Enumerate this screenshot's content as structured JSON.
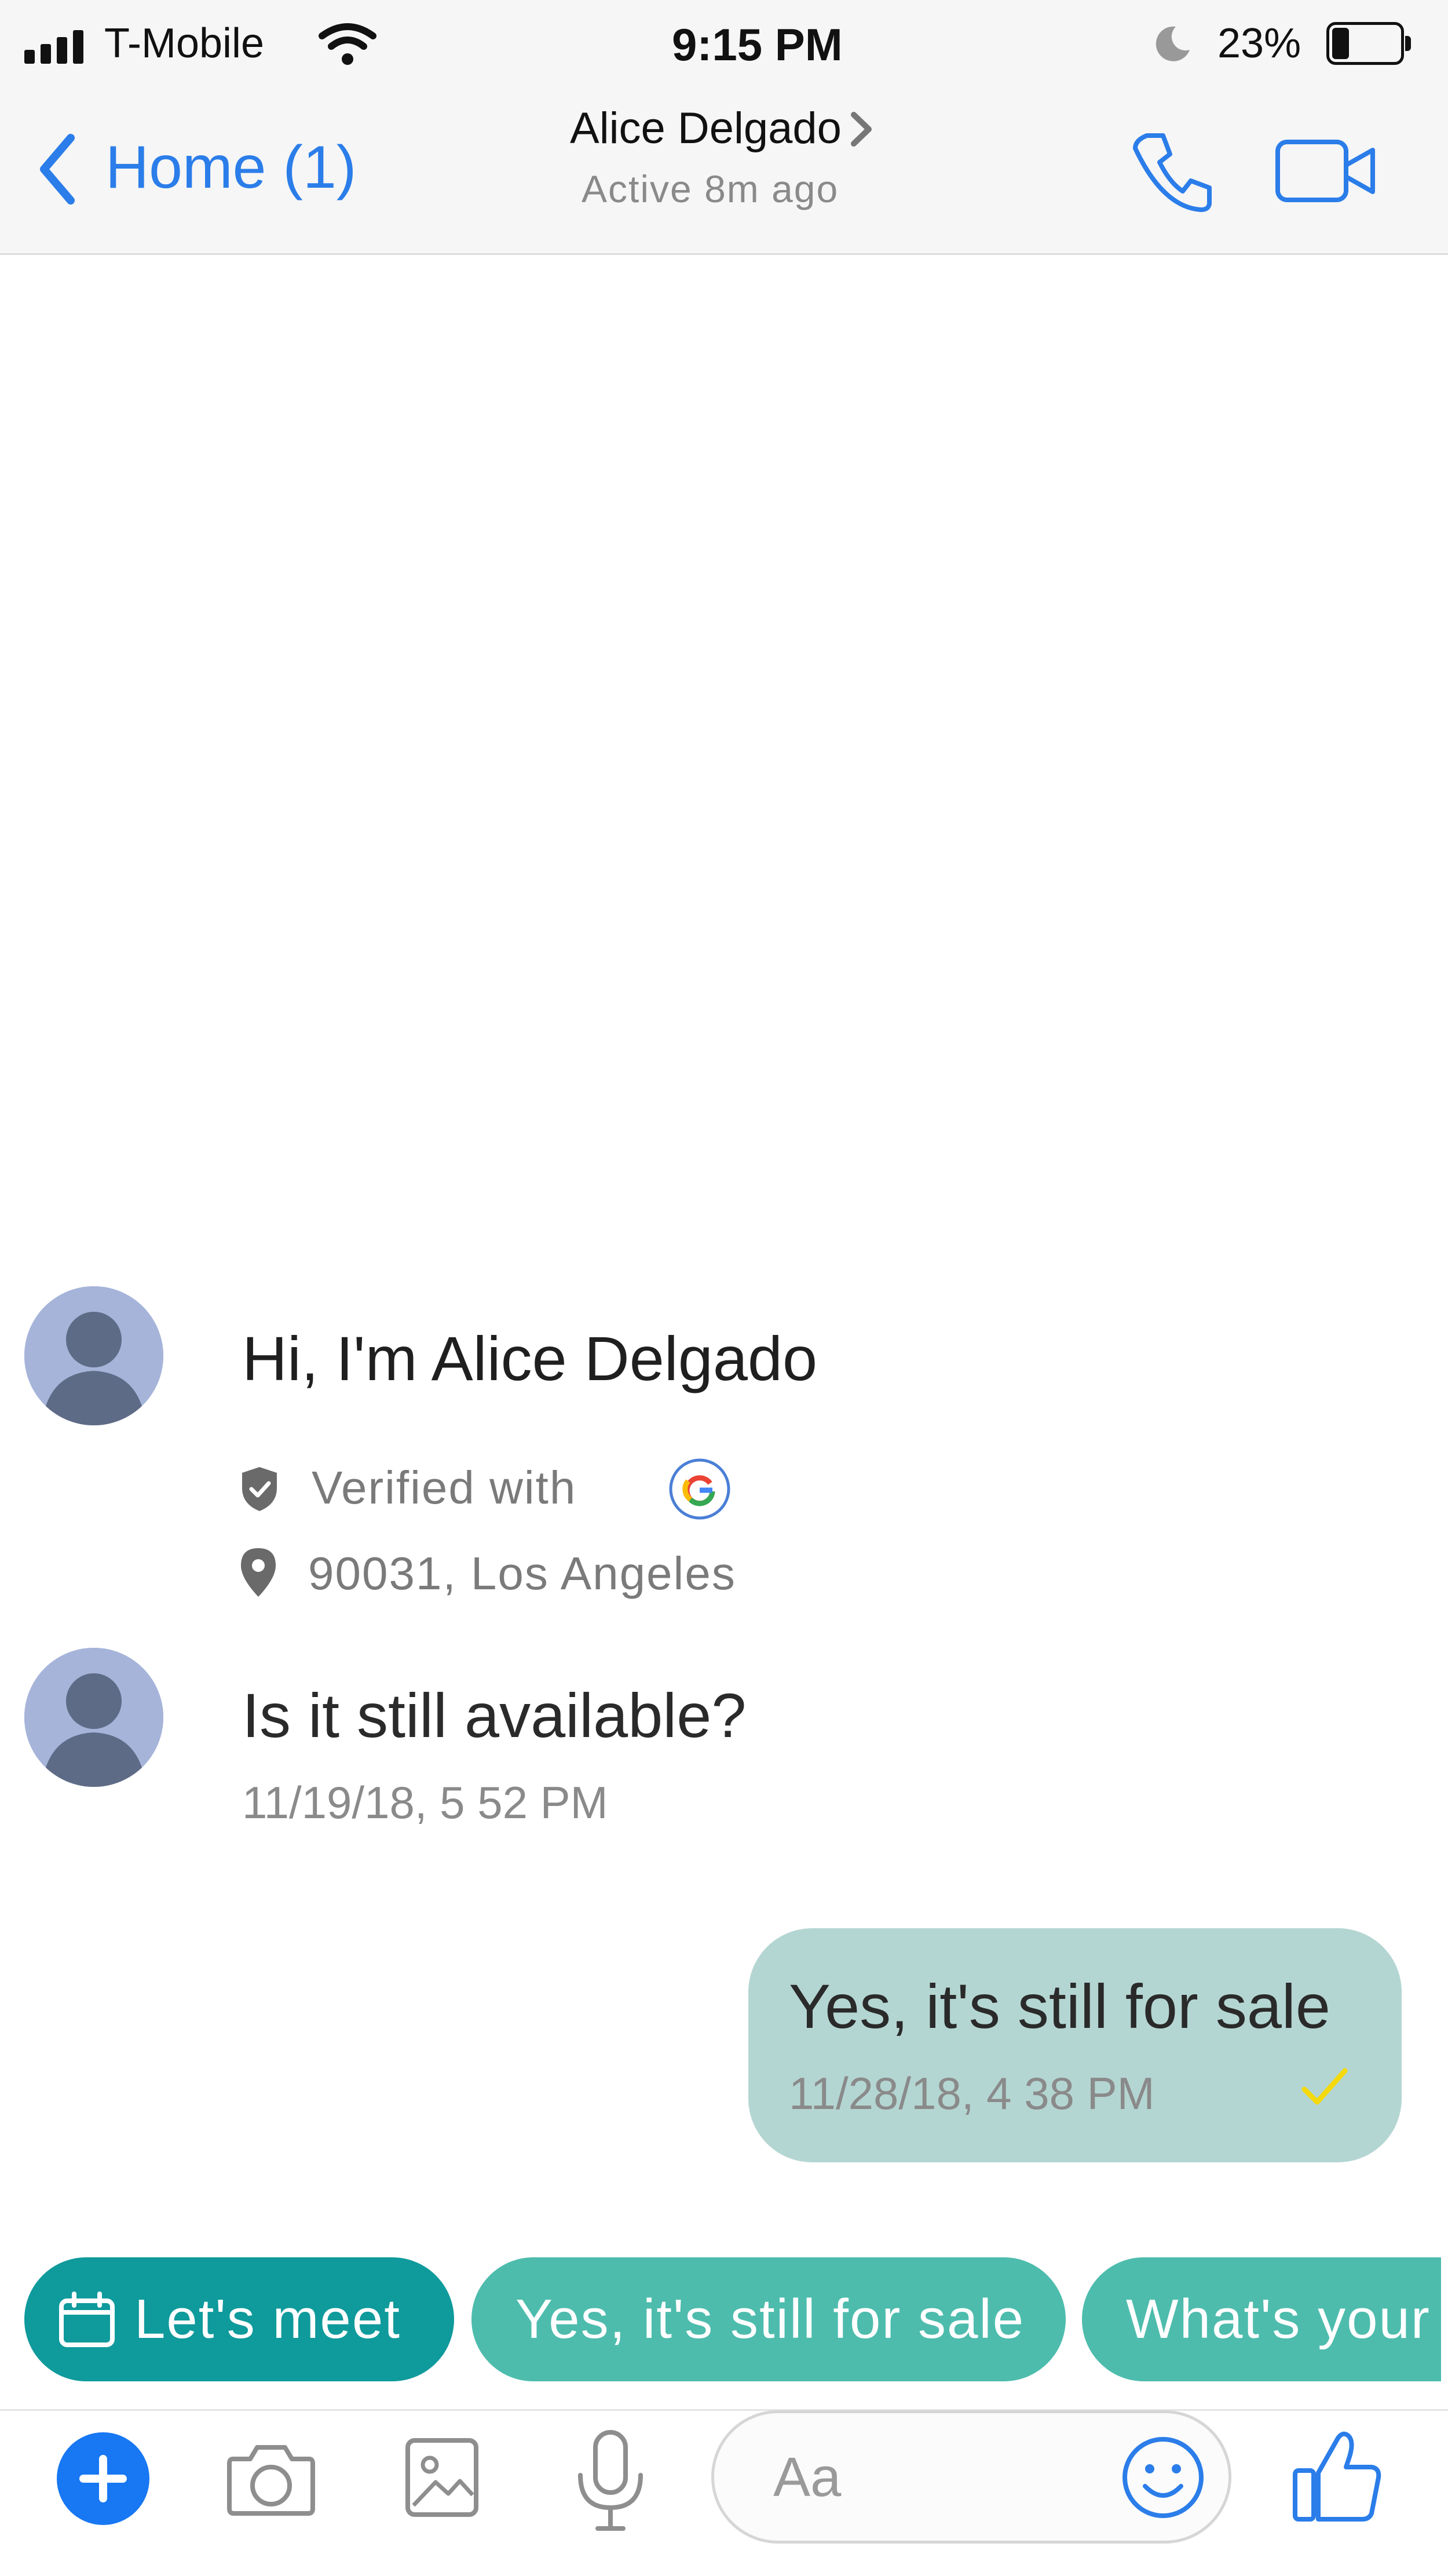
{
  "status_bar": {
    "carrier": "T-Mobile",
    "time": "9:15 PM",
    "battery_percent": "23%",
    "battery_level": 0.23
  },
  "header": {
    "back_label": "Home (1)",
    "contact_name": "Alice Delgado",
    "active_status": "Active 8m ago"
  },
  "profile_intro": {
    "greeting": "Hi, I'm Alice Delgado",
    "verified_label": "Verified with",
    "location": "90031, Los Angeles"
  },
  "messages": [
    {
      "direction": "incoming",
      "text": "Is it still available?",
      "time": "11/19/18, 5 52 PM"
    },
    {
      "direction": "outgoing",
      "text": "Yes, it's still for sale",
      "time": "11/28/18, 4 38 PM"
    }
  ],
  "quick_replies": [
    {
      "label": "Let's meet",
      "icon": "calendar-icon"
    },
    {
      "label": "Yes, it's still for sale"
    },
    {
      "label": "What's your"
    }
  ],
  "composer": {
    "placeholder": "Aa"
  },
  "colors": {
    "accent_blue": "#2b7de9",
    "chip_dark_teal": "#0f9a9c",
    "chip_teal": "#4dbcad",
    "bubble_outgoing": "#b4d6d2",
    "checkmark_yellow": "#f4d90c",
    "send_button_blue": "#1877f2"
  },
  "icons": {
    "signal": "signal-bars-icon",
    "wifi": "wifi-icon",
    "moon": "moon-icon",
    "battery": "battery-icon",
    "back": "chevron-left-icon",
    "name_chevron": "chevron-right-icon",
    "call": "phone-icon",
    "video": "video-camera-icon",
    "verified": "shield-check-icon",
    "google": "google-icon",
    "location": "location-pin-icon",
    "read_receipt": "checkmark-icon",
    "add": "plus-icon",
    "camera": "camera-icon",
    "gallery": "image-icon",
    "mic": "microphone-icon",
    "emoji": "smiley-icon",
    "like": "thumbs-up-icon"
  }
}
